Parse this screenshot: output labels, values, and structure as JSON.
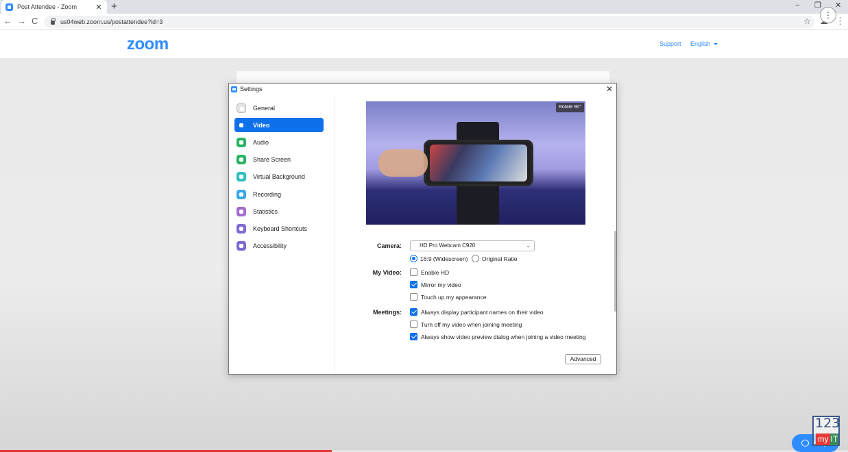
{
  "browser": {
    "tab_title": "Post Attendee - Zoom",
    "tab_close": "✕",
    "new_tab": "+",
    "url": "us04web.zoom.us/postattendee?id=3",
    "window_controls": {
      "minimize": "−",
      "restore": "❐",
      "close": "✕"
    },
    "nav": {
      "back": "←",
      "forward": "→",
      "reload": "C"
    },
    "star": "☆",
    "menu": "⋮",
    "ext": "☁",
    "overlay_dots": "⋮"
  },
  "zoom_header": {
    "logo": "zoom",
    "support_label": "Support",
    "language_label": "English"
  },
  "settings": {
    "title": "Settings",
    "close": "✕",
    "sidebar": [
      {
        "label": "General",
        "icon": "general-icon",
        "color": "#e4e4e4"
      },
      {
        "label": "Video",
        "icon": "video-icon",
        "color": "#ffffff",
        "active": true
      },
      {
        "label": "Audio",
        "icon": "audio-icon",
        "color": "#29b463"
      },
      {
        "label": "Share Screen",
        "icon": "share-screen-icon",
        "color": "#29b463"
      },
      {
        "label": "Virtual Background",
        "icon": "virtual-background-icon",
        "color": "#2fbfbd"
      },
      {
        "label": "Recording",
        "icon": "recording-icon",
        "color": "#38a8e8"
      },
      {
        "label": "Statistics",
        "icon": "statistics-icon",
        "color": "#a36bd1"
      },
      {
        "label": "Keyboard Shortcuts",
        "icon": "keyboard-icon",
        "color": "#7f6bd1"
      },
      {
        "label": "Accessibility",
        "icon": "accessibility-icon",
        "color": "#7f6bd1"
      }
    ],
    "video": {
      "rotate_label": "Rotate 90°",
      "camera_label": "Camera:",
      "camera_value": "HD Pro Webcam C920",
      "ratio_options": [
        {
          "label": "16:9 (Widescreen)",
          "selected": true
        },
        {
          "label": "Original Ratio",
          "selected": false
        }
      ],
      "my_video_label": "My Video:",
      "my_video_options": [
        {
          "label": "Enable HD",
          "checked": false
        },
        {
          "label": "Mirror my video",
          "checked": true
        },
        {
          "label": "Touch up my appearance",
          "checked": false
        }
      ],
      "meetings_label": "Meetings:",
      "meetings_options": [
        {
          "label": "Always display participant names on their video",
          "checked": true
        },
        {
          "label": "Turn off my video when joining meeting",
          "checked": false
        },
        {
          "label": "Always show video preview dialog when joining a video meeting",
          "checked": true
        }
      ],
      "advanced_label": "Advanced"
    }
  },
  "overlay": {
    "help_label": "Help",
    "brand": {
      "num": "123",
      "my": "my",
      "it": "IT"
    },
    "video_progress": 0.391
  }
}
